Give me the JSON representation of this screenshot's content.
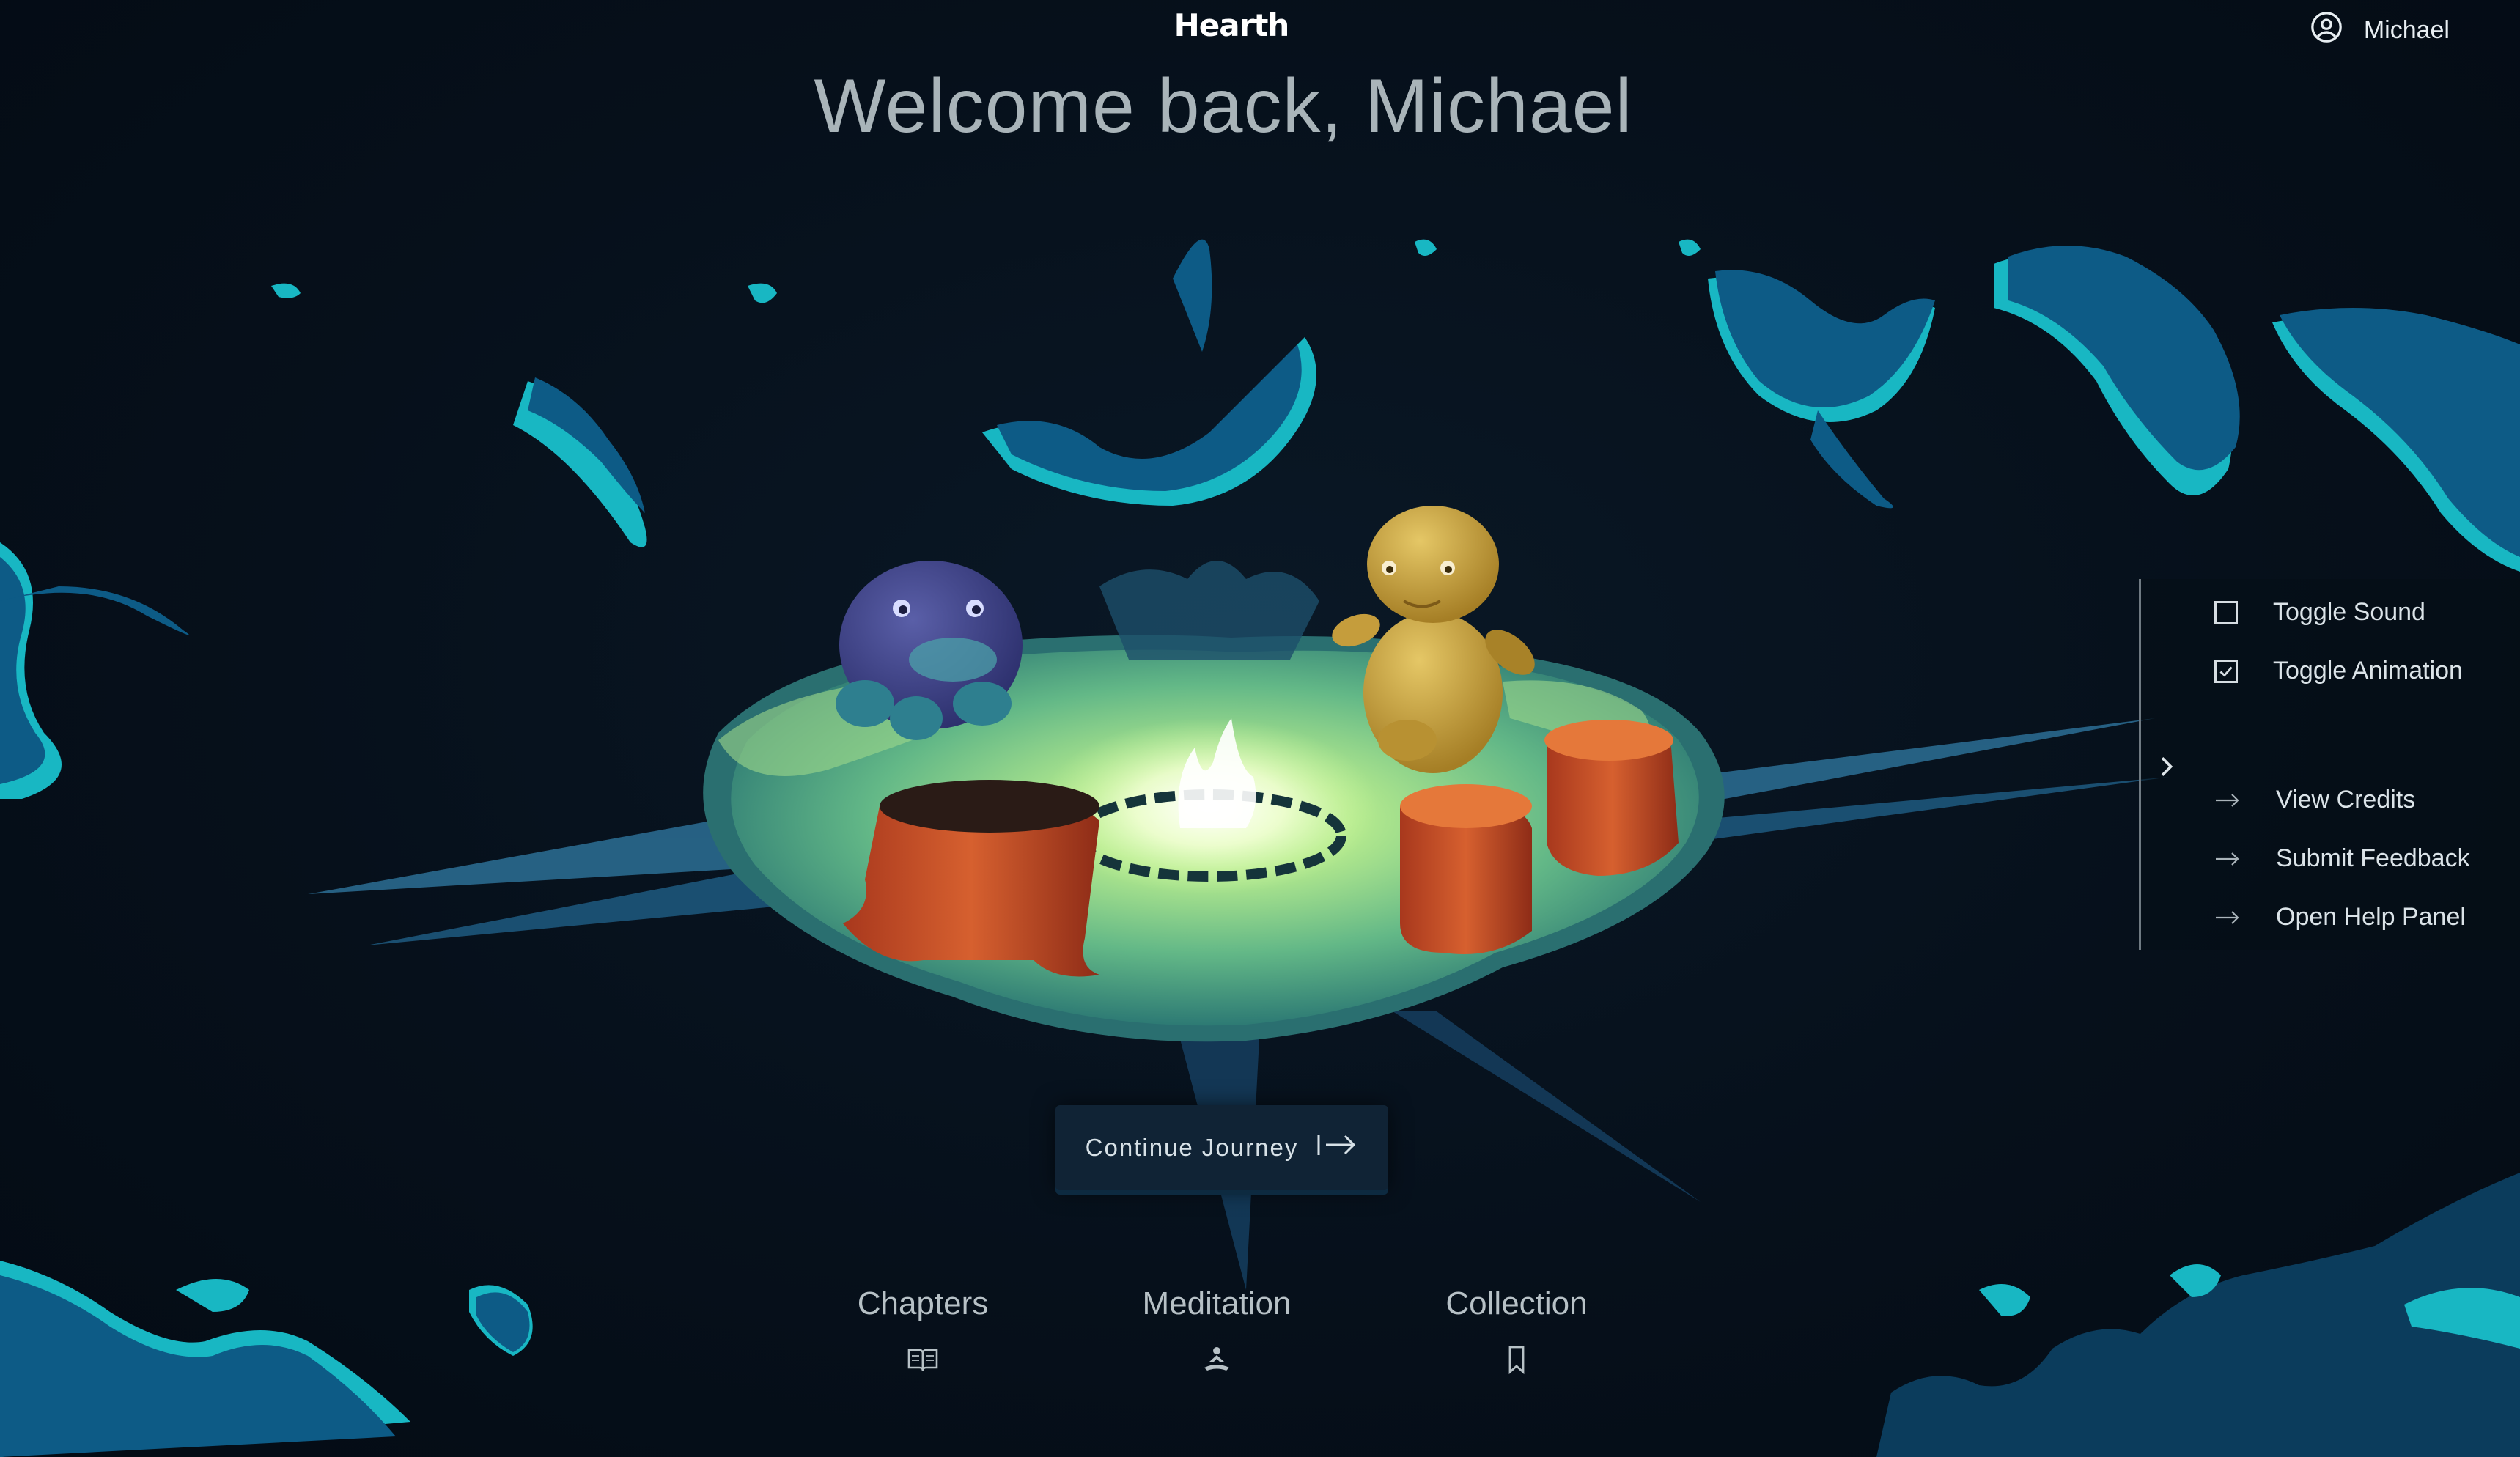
{
  "app": {
    "brand": "Hearth"
  },
  "header": {
    "user_name": "Michael",
    "user_icon": "user-circle-icon",
    "welcome": "Welcome back, Michael"
  },
  "side_panel": {
    "toggle_icon": "chevron-right-icon",
    "toggles": [
      {
        "label": "Toggle Sound",
        "checked": false
      },
      {
        "label": "Toggle Animation",
        "checked": true
      }
    ],
    "links": [
      {
        "label": "View Credits",
        "icon": "arrow-right-icon"
      },
      {
        "label": "Submit Feedback",
        "icon": "arrow-right-icon"
      },
      {
        "label": "Open Help Panel",
        "icon": "arrow-right-icon"
      }
    ]
  },
  "main": {
    "continue_label": "Continue Journey",
    "continue_icon": "arrow-right-to-bar-icon"
  },
  "bottom_nav": [
    {
      "label": "Chapters",
      "icon": "open-book-icon"
    },
    {
      "label": "Meditation",
      "icon": "meditation-icon"
    },
    {
      "label": "Collection",
      "icon": "bookmark-icon"
    }
  ],
  "colors": {
    "background": "#050f1a",
    "foliage": "#0d5b86",
    "foliage_edge": "#18b7c3",
    "clearing_light": "#b8ec8e",
    "clearing_dark": "#3e8d78",
    "purple_creature": "#3a3f86",
    "yellow_creature": "#c9a23c",
    "stump": "#c14a25",
    "button_bg": "#102335"
  }
}
